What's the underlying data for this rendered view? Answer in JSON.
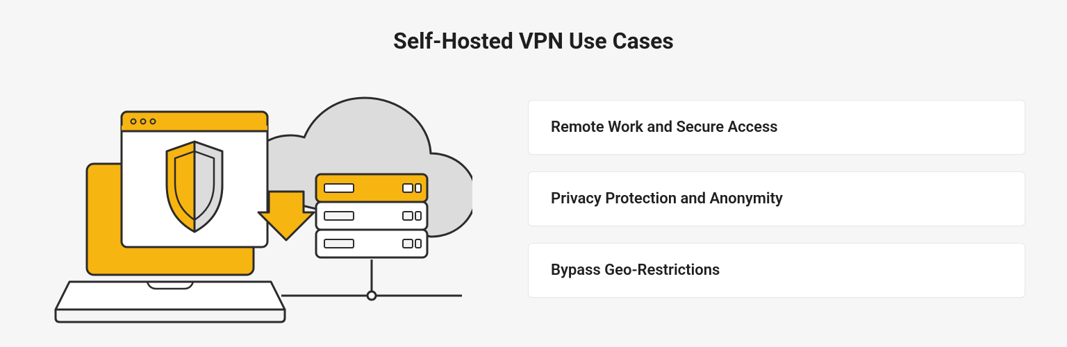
{
  "title": "Self-Hosted VPN Use Cases",
  "cards": [
    {
      "label": "Remote Work and Secure Access"
    },
    {
      "label": "Privacy Protection and Anonymity"
    },
    {
      "label": "Bypass Geo-Restrictions"
    }
  ],
  "icons": {
    "laptop": "laptop-icon",
    "browser_shield": "browser-shield-icon",
    "shield": "shield-icon",
    "cloud": "cloud-icon",
    "server": "server-rack-icon",
    "arrow": "arrow-down-icon"
  },
  "colors": {
    "accent": "#f7b512",
    "stroke": "#2b2b2b",
    "bg": "#f6f6f6",
    "card_bg": "#ffffff",
    "card_border": "#e7e7e7",
    "cloud_fill": "#dcdcdc",
    "light": "#f4f4f4"
  }
}
